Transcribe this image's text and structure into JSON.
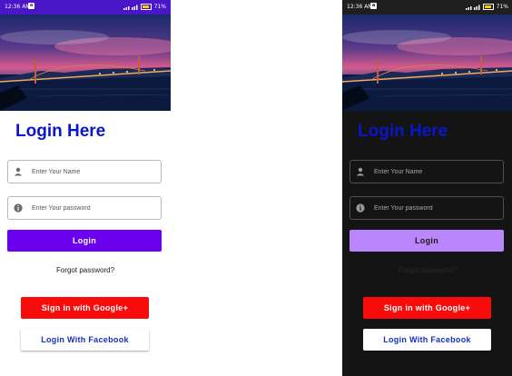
{
  "status_bar": {
    "time": "12:36 AM",
    "badge": "a",
    "battery": "71%"
  },
  "screen": {
    "title": "Login Here",
    "name_field": {
      "placeholder": "Enter Your Name",
      "value": ""
    },
    "password_field": {
      "placeholder": "Enter Your password",
      "value": ""
    },
    "login_label": "Login",
    "forgot_label": "Forgot password?",
    "google_label": "Sign in with Google+",
    "facebook_label": "Login With Facebook"
  },
  "icons": {
    "name_field": "person-icon",
    "password_field": "info-icon"
  },
  "colors": {
    "title": "#0a16c8",
    "login_light": "#6a00ee",
    "login_dark": "#bb86fc",
    "google": "#f70b0b",
    "facebook_text": "#1530b8",
    "dark_background": "#141414"
  }
}
